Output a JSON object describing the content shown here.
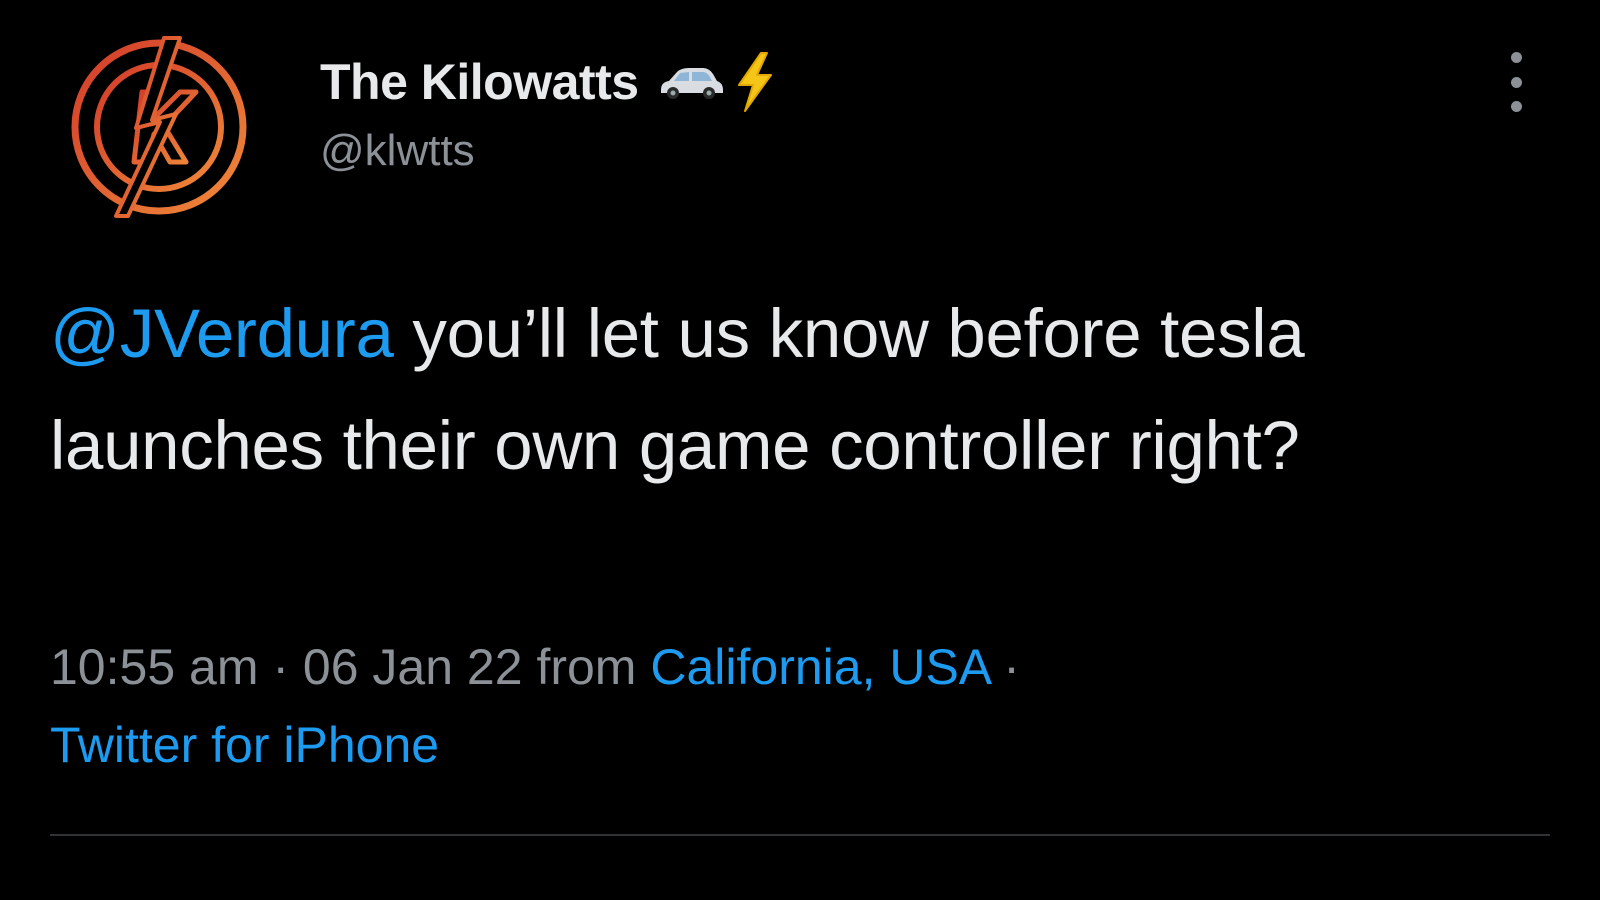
{
  "colors": {
    "background": "#000000",
    "text": "#e7e9ea",
    "muted": "#8b9196",
    "link": "#1d9bf0",
    "avatar_ring": "#e0582a"
  },
  "author": {
    "name": "The Kilowatts",
    "handle": "@klwtts",
    "emojis": [
      "car-icon",
      "lightning-bolt-icon"
    ],
    "avatar_icon": "kilowatts-logo"
  },
  "tweet": {
    "mention": "@JVerdura",
    "text": " you’ll let us know before tesla launches their own game controller right?"
  },
  "meta": {
    "time": "10:55 am",
    "separator1": " · ",
    "date": "06 Jan 22",
    "from_label": " from ",
    "location": "California, USA",
    "separator2": " ·",
    "source": "Twitter for iPhone"
  },
  "menu": {
    "icon": "more-vertical-icon"
  }
}
